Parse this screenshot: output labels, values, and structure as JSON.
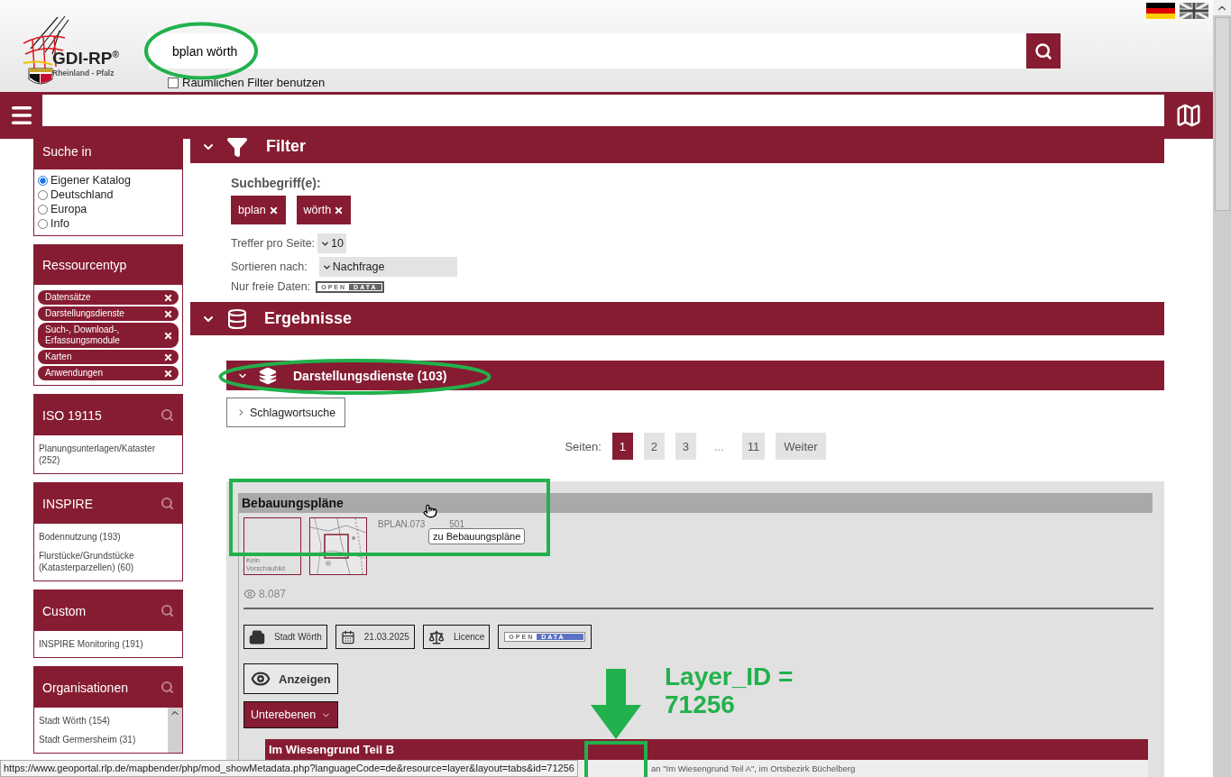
{
  "header": {
    "logo": {
      "name": "GDI-RP",
      "mark": "®",
      "subtitle": "Rheinland - Pfalz"
    },
    "search": {
      "value": "bplan wörth"
    },
    "spatial_filter": {
      "label": "Räumlichen Filter benutzen",
      "checked": false
    }
  },
  "sidebar": {
    "search_in": {
      "title": "Suche in",
      "options": [
        {
          "label": "Eigener Katalog",
          "selected": true
        },
        {
          "label": "Deutschland",
          "selected": false
        },
        {
          "label": "Europa",
          "selected": false
        },
        {
          "label": "Info",
          "selected": false
        }
      ]
    },
    "resource_types": {
      "title": "Ressourcentyp",
      "items": [
        "Datensätze",
        "Darstellungsdienste",
        "Such-, Download-, Erfassungsmodule",
        "Karten",
        "Anwendungen"
      ]
    },
    "facets": [
      {
        "title": "ISO 19115",
        "items": [
          "Planungsunterlagen/Kataster (252)"
        ],
        "scrollable": false
      },
      {
        "title": "INSPIRE",
        "items": [
          "Bodennutzung (193)",
          "Flurstücke/Grundstücke (Katasterparzellen) (60)"
        ],
        "scrollable": false
      },
      {
        "title": "Custom",
        "items": [
          "INSPIRE Monitoring (191)"
        ],
        "scrollable": false
      },
      {
        "title": "Organisationen",
        "items": [
          "Stadt Wörth (154)",
          "Stadt Germersheim (31)"
        ],
        "scrollable": true
      }
    ]
  },
  "filter": {
    "title": "Filter",
    "terms_label": "Suchbegriff(e):",
    "terms": [
      "bplan",
      "wörth"
    ],
    "per_page": {
      "label": "Treffer pro Seite:",
      "value": "10"
    },
    "sort": {
      "label": "Sortieren nach:",
      "value": "Nachfrage"
    },
    "open_data": {
      "label": "Nur freie Daten:",
      "badge_left": "OPEN",
      "badge_right": "DATA",
      "selected": false
    }
  },
  "results": {
    "title": "Ergebnisse",
    "group": {
      "title": "Darstellungsdienste (103)"
    },
    "keyword_button": "Schlagwortsuche",
    "pager": {
      "label": "Seiten:",
      "pages": [
        {
          "label": "1",
          "kind": "page",
          "selected": true
        },
        {
          "label": "2",
          "kind": "page",
          "selected": false
        },
        {
          "label": "3",
          "kind": "page",
          "selected": false
        },
        {
          "label": "...",
          "kind": "gap"
        },
        {
          "label": "11",
          "kind": "page",
          "selected": false
        }
      ],
      "next": "Weiter"
    },
    "card": {
      "title": "Bebauungspläne",
      "no_preview": "Kein Vorschaubild",
      "identifier_parts": [
        "BPLAN.073",
        "501"
      ],
      "tooltip": "zu Bebauungspläne",
      "views": "8.087",
      "meta": [
        {
          "kind": "organisation",
          "label": "Stadt Wörth"
        },
        {
          "kind": "date",
          "label": "21.03.2025"
        },
        {
          "kind": "licence",
          "label": "Licence"
        },
        {
          "kind": "opendata",
          "left": "OPEN",
          "right": "DATA"
        }
      ],
      "show_button": "Anzeigen",
      "sublayers_button": "Unterebenen",
      "sublayer": {
        "title": "Im Wiesengrund Teil B",
        "description": "an \"Im Wiesengrund Teil A\", im Ortsbezirk Büchelberg"
      }
    }
  },
  "status_bar": {
    "url": "https://www.geoportal.rlp.de/mapbender/php/mod_showMetadata.php?languageCode=de&resource=layer&layout=tabs&id=71256"
  },
  "annotation": {
    "lines": [
      "Layer_ID =",
      "71256"
    ]
  }
}
